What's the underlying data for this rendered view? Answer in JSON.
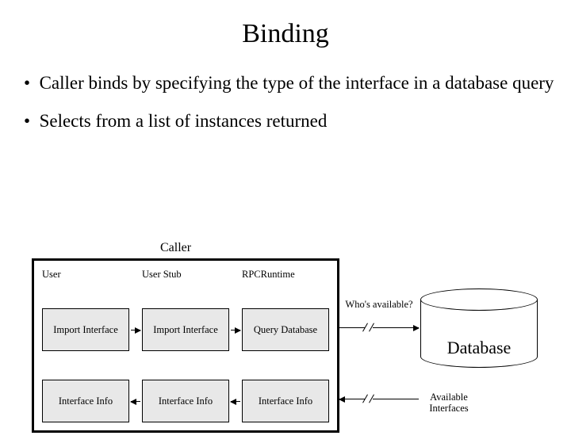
{
  "title": "Binding",
  "bullets": [
    "Caller binds by specifying the type of the interface in a database query",
    "Selects from a list of instances returned"
  ],
  "diagram": {
    "caller_label": "Caller",
    "columns": {
      "user": {
        "header": "User",
        "row1": "Import Interface",
        "row2": "Interface Info"
      },
      "stub": {
        "header": "User Stub",
        "row1": "Import Interface",
        "row2": "Interface Info"
      },
      "runtime": {
        "header": "RPCRuntime",
        "row1": "Query Database",
        "row2": "Interface Info"
      }
    },
    "external_labels": {
      "query": "Who's available?",
      "response": "Available Interfaces"
    },
    "database_label": "Database"
  }
}
